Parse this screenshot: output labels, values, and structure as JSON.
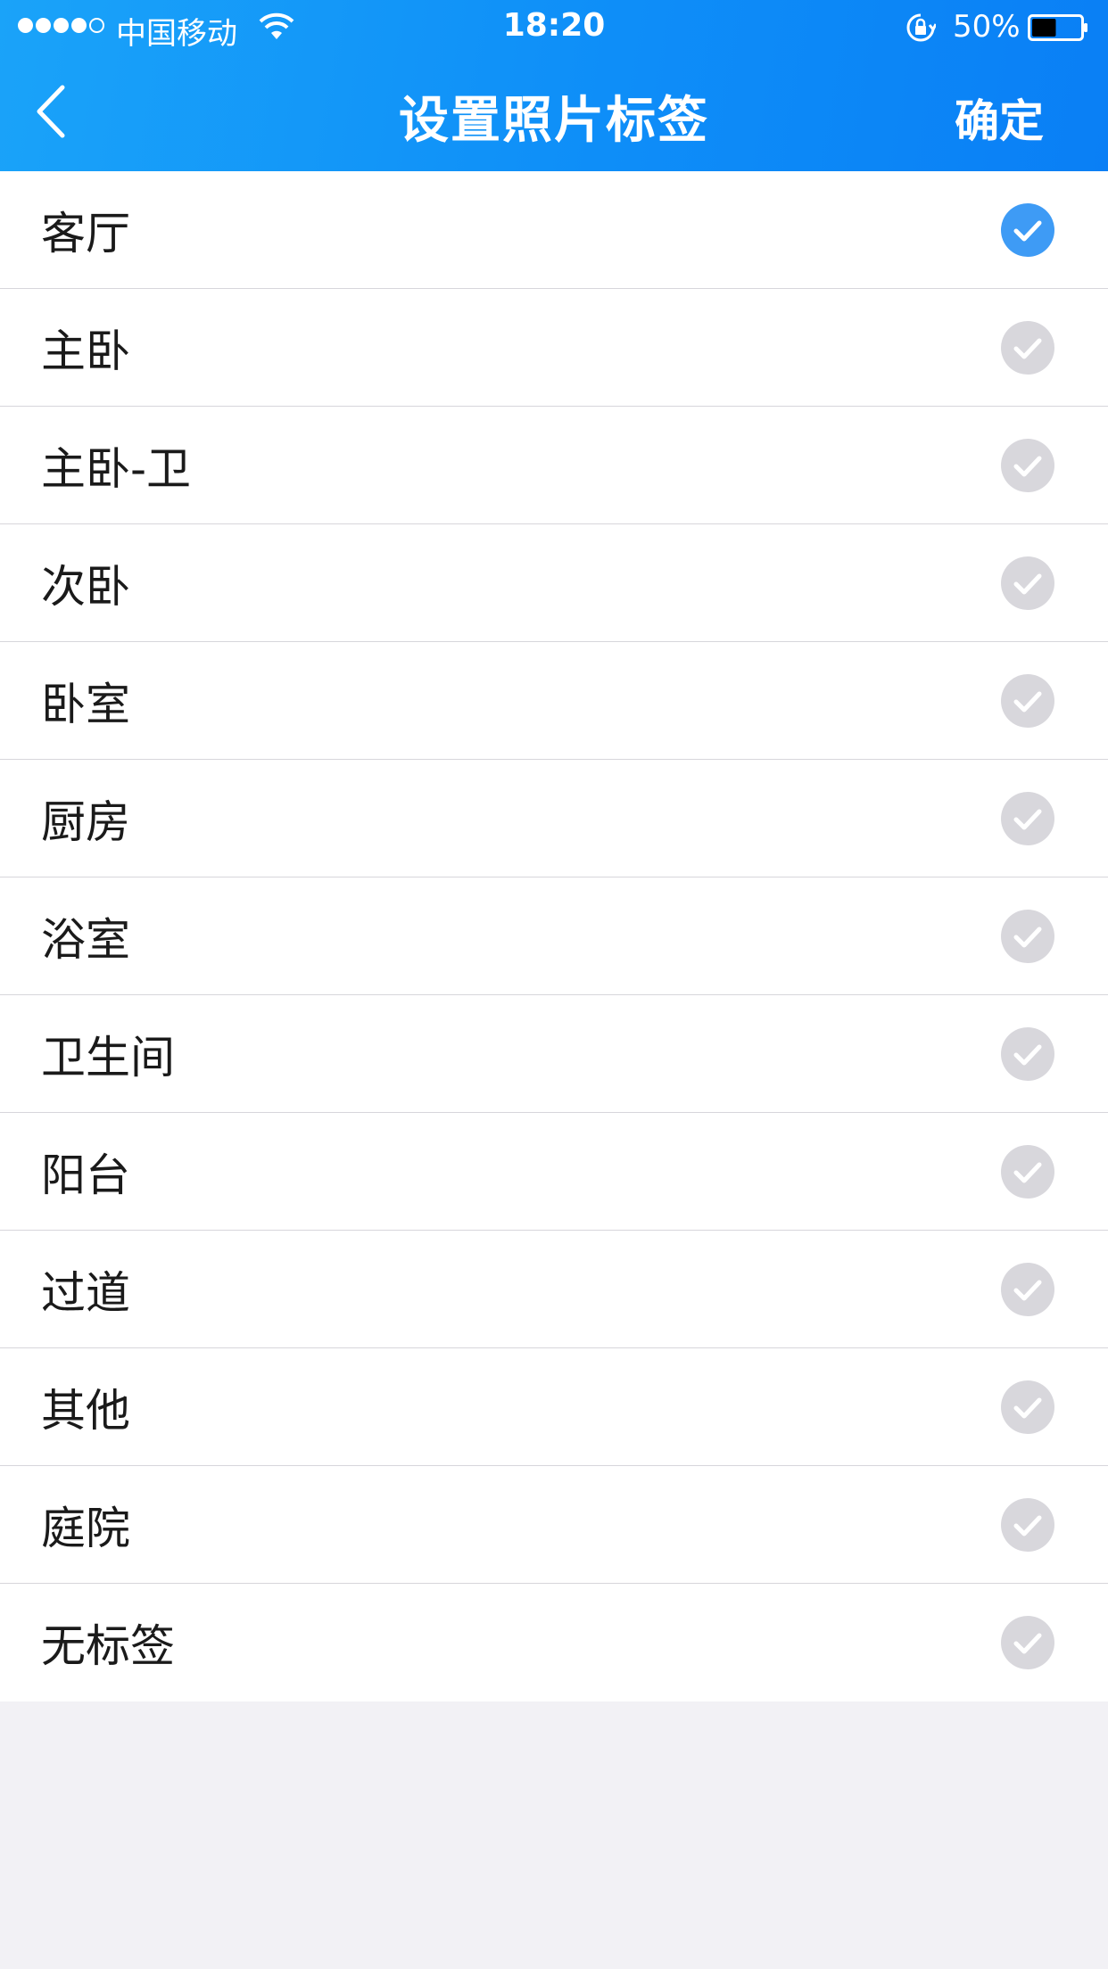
{
  "status_bar": {
    "carrier": "中国移动",
    "time": "18:20",
    "battery_percent": "50%",
    "battery_level": 0.5,
    "signal_bars": 4,
    "signal_total": 5
  },
  "nav": {
    "title": "设置照片标签",
    "confirm_label": "确定"
  },
  "colors": {
    "accent": "#3e9bf5",
    "unchecked": "#d8d7dc",
    "header_gradient_start": "#1aa3f9",
    "header_gradient_end": "#0a7ff5",
    "background": "#f2f1f5"
  },
  "tags": [
    {
      "label": "客厅",
      "selected": true
    },
    {
      "label": "主卧",
      "selected": false
    },
    {
      "label": "主卧-卫",
      "selected": false
    },
    {
      "label": "次卧",
      "selected": false
    },
    {
      "label": "卧室",
      "selected": false
    },
    {
      "label": "厨房",
      "selected": false
    },
    {
      "label": "浴室",
      "selected": false
    },
    {
      "label": "卫生间",
      "selected": false
    },
    {
      "label": "阳台",
      "selected": false
    },
    {
      "label": "过道",
      "selected": false
    },
    {
      "label": "其他",
      "selected": false
    },
    {
      "label": "庭院",
      "selected": false
    },
    {
      "label": "无标签",
      "selected": false
    }
  ]
}
